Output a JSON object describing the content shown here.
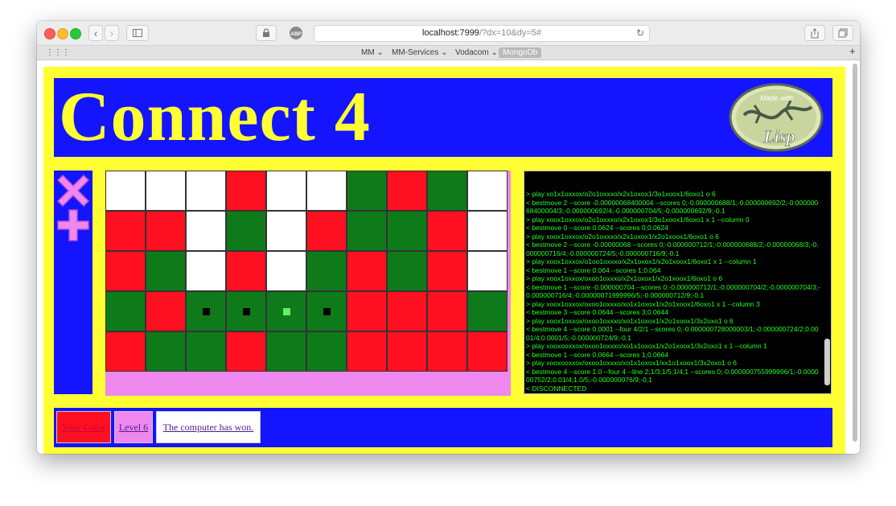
{
  "browser": {
    "url_host": "localhost:7999",
    "url_path": "/?dx=10&dy=5#",
    "bookmarks": [
      "MM",
      "MM-Services",
      "Vodacom",
      "MongoDb"
    ]
  },
  "page": {
    "title": "Connect 4",
    "logo_text": "Made with Lisp",
    "colors": {
      "page_bg": "#ffff33",
      "panel_bg": "#1414ff",
      "red": "#ff1020",
      "green": "#0f7a1a",
      "pink": "#ee88ee"
    }
  },
  "board": {
    "rows": [
      [
        "w",
        "w",
        "w",
        "r",
        "w",
        "w",
        "g",
        "r",
        "g",
        "w"
      ],
      [
        "r",
        "r",
        "w",
        "g",
        "w",
        "r",
        "g",
        "g",
        "r",
        "w"
      ],
      [
        "r",
        "g",
        "w",
        "r",
        "w",
        "g",
        "r",
        "g",
        "r",
        "w"
      ],
      [
        "g",
        "r",
        "g",
        "g",
        "g",
        "g",
        "r",
        "r",
        "r",
        "g"
      ],
      [
        "r",
        "g",
        "g",
        "r",
        "g",
        "g",
        "r",
        "r",
        "r",
        "r"
      ]
    ],
    "win_markers": {
      "row": 3,
      "cols": [
        2,
        3,
        4,
        5
      ],
      "highlight_col": 4
    }
  },
  "console": {
    "lines": [
      "> play xo1x1oxxox/o2o1oxxxo/x2x1oxox1/3o1xoox1/6oxo1 o 6",
      "< bestmove 2 --score -0.00000068400004 --scores 0;-0.000000688/1;-0.000000692/2;-0.00000068400004/3;-0.000000692/4;-0.000000704/5;-0.000000692/9;-0.1",
      "> play xoox1oxxox/o2o1oxxxo/x2x1oxox1/3o1xoox1/6oxo1 x 1 --column 0",
      "< bestmove 0 --score 0.0624 --scores 0;0.0624",
      "> play xoox1oxxox/o2o1oxxxo/x2x1oxox1/x2o1xoox1/6oxo1 o 6",
      "< bestmove 2 --score -0.00000068 --scores 0;-0.000000712/1;-0.000000688/2;-0.00000068/3;-0.000000716/4;-0.000000724/5;-0.000000716/9;-0.1",
      "> play xoox1oxxox/o1oo1oxxxo/x2x1oxox1/x2o1xoox1/6oxo1 x 1 --column 1",
      "< bestmove 1 --score 0.064 --scores 1;0.064",
      "> play xoox1oxxox/oxoo1oxxxo/x2x1oxox1/x2o1xoox1/6oxo1 o 6",
      "< bestmove 1 --score -0.000000704 --scores 0;-0.000000712/1;-0.000000704/2;-0.000000704/3;-0.000000716/4;-0.00000071999996/5;-0.000000712/9;-0.1",
      "> play xoox1oxxox/oxoo1oxxxo/xo1x1oxox1/x2o1xoox1/6oxo1 x 1 --column 3",
      "< bestmove 3 --score 0.0644 --scores 3;0.0644",
      "> play xoox1oxxox/oxoo1oxxxo/xo1x1oxox1/x2o1xoox1/3x2oxo1 o 6",
      "< bestmove 4 --score 0.0001 --four 4/2/1 --scores 0;-0.000000728000003/1;-0.000000724/2;0.0001/4;0.0001/5;-0.000000724/9;-0.1",
      "> play xooxooxxox/oxoo1oxxxo/xo1x1oxox1/x2o1xoox1/3x2oxo1 x 1 --column 1",
      "< bestmove 1 --score 0.0664 --scores 1;0.0664",
      "> play xooxooxxox/oxoo1oxxxo/xo1x1oxox1/xx1o1xoox1/3x2oxo1 o 6",
      "< bestmove 4 --score 1.0 --four 4 --line 2;1/3;1/5;1/4;1 --scores 0;-0.000000755999996/1;-0.000000752/2;0.01/4;1.0/5;-0.000000076/9;-0.1",
      "< DISCONNECTED"
    ]
  },
  "footer": {
    "color_button": "Your Color",
    "level_button": "Level 6",
    "status": "The computer has won."
  }
}
